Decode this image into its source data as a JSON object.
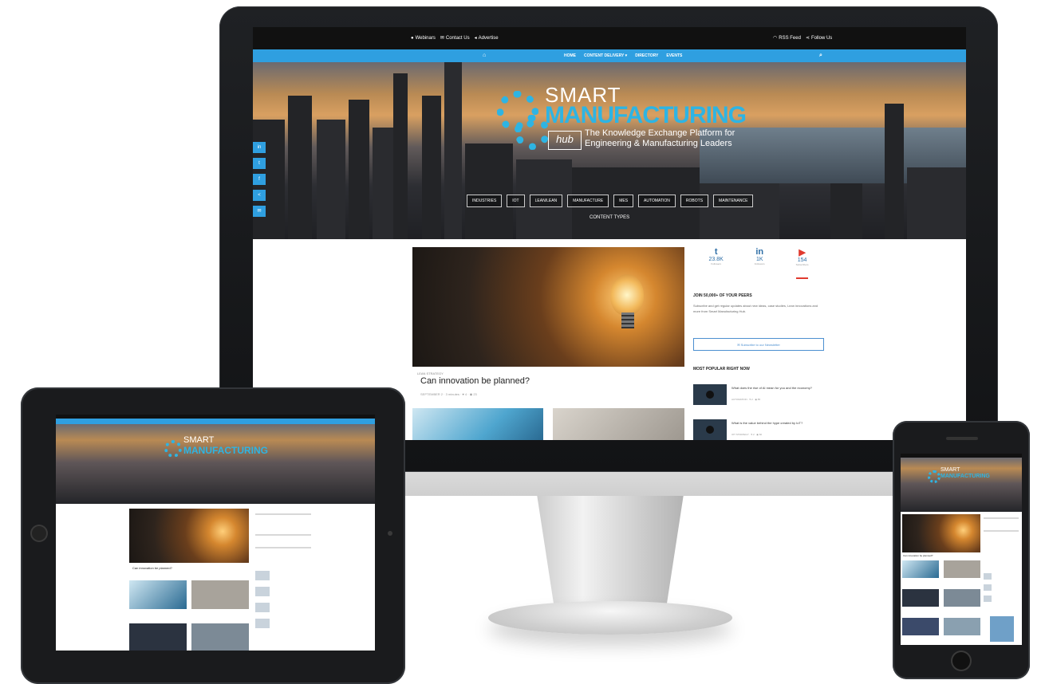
{
  "desktop": {
    "topbar": {
      "left_items": [
        "Webinars",
        "Contact Us",
        "Advertise"
      ],
      "right_items": [
        "RSS Feed",
        "Follow Us"
      ]
    },
    "nav": [
      "HOME",
      "CONTENT DELIVERY ▾",
      "DIRECTORY",
      "EVENTS"
    ],
    "brand": {
      "line1": "SMART",
      "line2": "MANUFACTURING",
      "hub": "hub",
      "tagline1": "The Knowledge Exchange Platform for",
      "tagline2": "Engineering & Manufacturing Leaders"
    },
    "social_rail": [
      "in",
      "t",
      "f",
      "<",
      "✉"
    ],
    "categories": [
      "INDUSTRIES",
      "IOT",
      "LEAN/LEAN",
      "MANUFACTURE",
      "MES",
      "AUTOMATION",
      "ROBOTS",
      "MAINTENANCE"
    ],
    "content_types": "CONTENT TYPES",
    "featured": {
      "meta": "LEAN STRATEGY",
      "title": "Can innovation be planned?",
      "info": "SEPTEMBER 2  ·  3 minutes  ·  ♥ 4  ·  ◉ 23"
    },
    "stats": [
      {
        "icon": "t",
        "count": "23.8K",
        "label": "Followers"
      },
      {
        "icon": "in",
        "count": "1K",
        "label": "Followers"
      },
      {
        "icon": "▶",
        "count": "154",
        "label": "Subscribers"
      }
    ],
    "join_title": "JOIN 50,000+ OF YOUR PEERS",
    "join_text": "Subscribe and get regular updates about new ideas, case studies, Lean innovations and more from Smart Manufacturing Hub.",
    "subscribe_btn": "✉  Subscribe to our Newsletter",
    "most_popular": "MOST POPULAR RIGHT NOW",
    "popular": [
      {
        "title": "What does the rise of AI mean for you and the economy?",
        "meta": "AUTOMATION  ·  ♥ 2  ·  ◉ 85"
      },
      {
        "title": "What is the value behind the hype created by IoT?",
        "meta": "IOT STRATEGY  ·  ♥ 2  ·  ◉ 60"
      }
    ]
  },
  "tablet": {
    "brand1": "SMART",
    "brand2": "MANUFACTURING",
    "featured_title": "Can innovation be planned?"
  },
  "phone": {
    "brand1": "SMART",
    "brand2": "MANUFACTURING",
    "featured_title": "Can innovation be planned?"
  },
  "colors": {
    "accent": "#2f9fe0",
    "brand": "#2eb4e3",
    "youtube": "#e03a2f",
    "bezel": "#1a1b1d"
  }
}
